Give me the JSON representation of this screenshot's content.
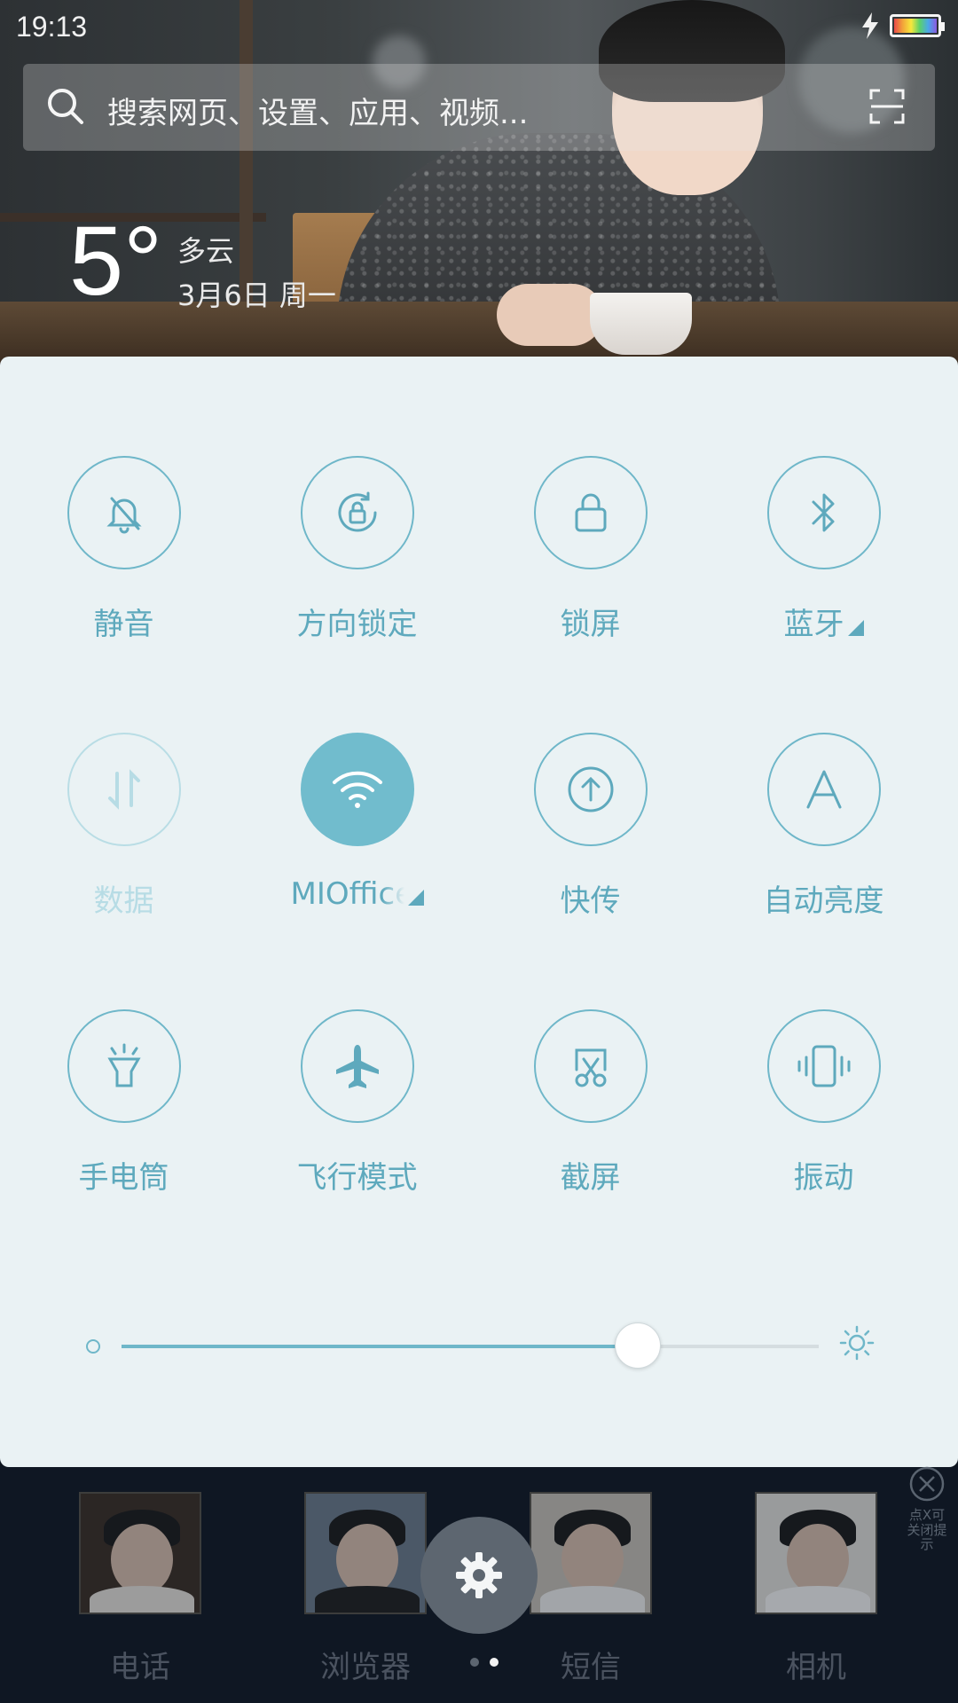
{
  "status_bar": {
    "time": "19:13",
    "charging_icon": "lightning-icon",
    "battery_icon": "battery-icon"
  },
  "search": {
    "placeholder": "搜索网页、设置、应用、视频...",
    "search_icon": "search-icon",
    "scan_icon": "scan-icon"
  },
  "weather": {
    "temperature": "5°",
    "condition": "多云",
    "date": "3月6日 周一"
  },
  "toggles": [
    {
      "label": "静音",
      "icon": "bell-off-icon",
      "state": "off",
      "has_menu": false
    },
    {
      "label": "方向锁定",
      "icon": "rotation-lock-icon",
      "state": "off",
      "has_menu": false
    },
    {
      "label": "锁屏",
      "icon": "lock-icon",
      "state": "off",
      "has_menu": false
    },
    {
      "label": "蓝牙",
      "icon": "bluetooth-icon",
      "state": "off",
      "has_menu": true
    },
    {
      "label": "数据",
      "icon": "data-transfer-icon",
      "state": "disabled",
      "has_menu": false
    },
    {
      "label": "MIOffice",
      "icon": "wifi-icon",
      "state": "on",
      "has_menu": true
    },
    {
      "label": "快传",
      "icon": "upload-icon",
      "state": "off",
      "has_menu": false
    },
    {
      "label": "自动亮度",
      "icon": "auto-brightness-icon",
      "state": "off",
      "has_menu": false
    },
    {
      "label": "手电筒",
      "icon": "flashlight-icon",
      "state": "off",
      "has_menu": false
    },
    {
      "label": "飞行模式",
      "icon": "airplane-icon",
      "state": "off",
      "has_menu": false
    },
    {
      "label": "截屏",
      "icon": "screenshot-icon",
      "state": "off",
      "has_menu": false
    },
    {
      "label": "振动",
      "icon": "vibrate-icon",
      "state": "off",
      "has_menu": false
    }
  ],
  "brightness": {
    "level": 0.74,
    "low_icon": "brightness-low-icon",
    "high_icon": "brightness-high-icon"
  },
  "dock": {
    "apps": [
      {
        "name": "电话"
      },
      {
        "name": "浏览器"
      },
      {
        "name": "短信"
      },
      {
        "name": "相机"
      }
    ],
    "close_hint": "点X可关闭提示",
    "settings_icon": "gear-icon"
  },
  "colors": {
    "accent": "#71bccd",
    "panel_bg": "#eaf2f4",
    "label": "#5ea9bd",
    "dock_bg": "#0f1723"
  }
}
